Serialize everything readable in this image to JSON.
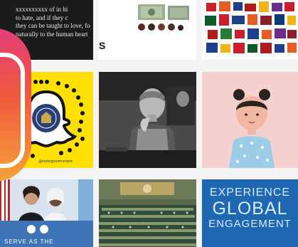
{
  "tiles": {
    "quote": {
      "lines": [
        "xxxxxxxxxx of in hi",
        "to hate, and if they c",
        "they can be taught to love, fo",
        "naturally to the human heart"
      ]
    },
    "bills": {
      "letter": "S"
    },
    "snapcode": {
      "handle": "@stategovernment"
    },
    "global": {
      "line1": "EXPERIENCE",
      "line2": "GLOBAL",
      "line3": "ENGAGEMENT"
    },
    "un": {
      "caption": "SERVE AS THE"
    }
  },
  "colors": {
    "instagram_gradient": [
      "#e43d7a",
      "#ef5a3c",
      "#f6a33a"
    ],
    "snapchat_yellow": "#ffe000",
    "un_blue": "#1f67b0"
  }
}
